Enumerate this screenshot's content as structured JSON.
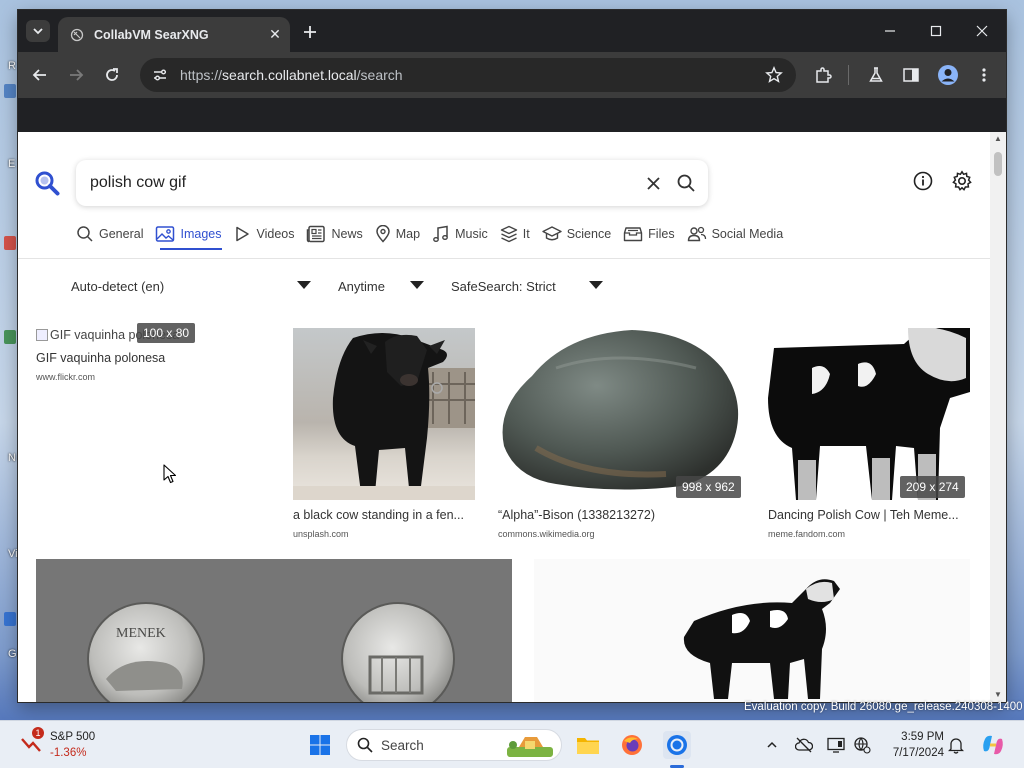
{
  "desktop": {
    "edge_letters": [
      "R",
      "E",
      "N",
      "Vi",
      "G"
    ]
  },
  "browser": {
    "tab_title": "CollabVM SearXNG",
    "url_scheme": "https://",
    "url_host": "search.collabnet.local",
    "url_path": "/search"
  },
  "search": {
    "query": "polish cow gif",
    "categories": [
      {
        "label": "General",
        "icon": "search-icon",
        "active": false
      },
      {
        "label": "Images",
        "icon": "image-icon",
        "active": true
      },
      {
        "label": "Videos",
        "icon": "play-icon",
        "active": false
      },
      {
        "label": "News",
        "icon": "newspaper-icon",
        "active": false
      },
      {
        "label": "Map",
        "icon": "map-pin-icon",
        "active": false
      },
      {
        "label": "Music",
        "icon": "music-note-icon",
        "active": false
      },
      {
        "label": "It",
        "icon": "layers-icon",
        "active": false
      },
      {
        "label": "Science",
        "icon": "graduation-cap-icon",
        "active": false
      },
      {
        "label": "Files",
        "icon": "file-tray-icon",
        "active": false
      },
      {
        "label": "Social Media",
        "icon": "people-icon",
        "active": false
      }
    ],
    "filters": {
      "language": "Auto-detect (en)",
      "time": "Anytime",
      "safesearch": "SafeSearch: Strict"
    }
  },
  "results": [
    {
      "alt": "GIF vaquinha polonesa",
      "title": "GIF vaquinha polonesa",
      "host": "www.flickr.com",
      "dims": "100 x 80"
    },
    {
      "title": "a black cow standing in a fen...",
      "host": "unsplash.com",
      "dims": ""
    },
    {
      "title": "“Alpha”-Bison (1338213272)",
      "host": "commons.wikimedia.org",
      "dims": "998 x 962"
    },
    {
      "title": "Dancing Polish Cow | Teh Meme...",
      "host": "meme.fandom.com",
      "dims": "209 x 274"
    },
    {
      "title": "",
      "host": "",
      "dims": ""
    },
    {
      "title": "",
      "host": "",
      "dims": ""
    }
  ],
  "coin_legend": "MENEK",
  "watermark": "Evaluation copy. Build 26080.ge_release.240308-1400",
  "taskbar": {
    "stock_name": "S&P 500",
    "stock_change": "-1.36%",
    "stock_badge": "1",
    "search_label": "Search",
    "time": "3:59 PM",
    "date": "7/17/2024"
  },
  "colors": {
    "accent": "#3050d0",
    "chrome_dark": "#202124",
    "chrome_toolbar": "#3c3c3c",
    "stock_down": "#c42b1c"
  }
}
